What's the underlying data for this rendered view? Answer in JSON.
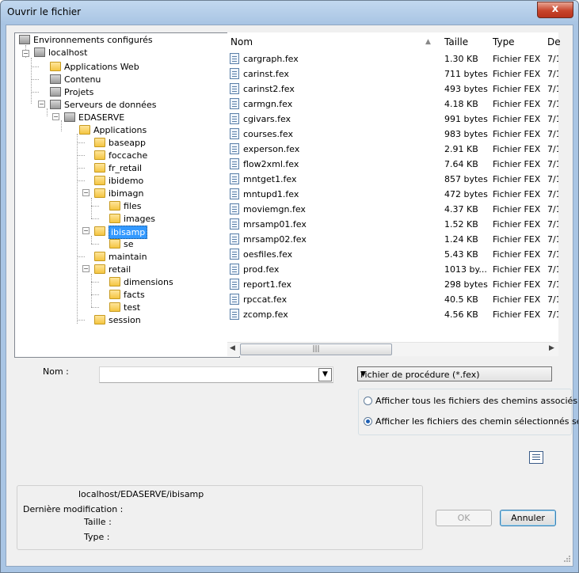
{
  "window": {
    "title": "Ouvrir le fichier",
    "close_label": "x"
  },
  "tree": [
    {
      "label": "Environnements configurés",
      "icon": "network-icon"
    },
    {
      "label": "localhost",
      "icon": "server-icon"
    },
    {
      "label": "Applications Web",
      "icon": "web-folder-icon"
    },
    {
      "label": "Contenu",
      "icon": "content-icon"
    },
    {
      "label": "Projets",
      "icon": "projects-icon"
    },
    {
      "label": "Serveurs de données",
      "icon": "server-icon"
    },
    {
      "label": "EDASERVE",
      "icon": "server-icon"
    },
    {
      "label": "Applications",
      "icon": "folder-open-icon"
    },
    {
      "label": "baseapp",
      "icon": "folder-icon"
    },
    {
      "label": "foccache",
      "icon": "folder-icon"
    },
    {
      "label": "fr_retail",
      "icon": "folder-icon"
    },
    {
      "label": "ibidemo",
      "icon": "folder-icon"
    },
    {
      "label": "ibimagn",
      "icon": "folder-icon"
    },
    {
      "label": "files",
      "icon": "folder-icon"
    },
    {
      "label": "images",
      "icon": "folder-icon"
    },
    {
      "label": "ibisamp",
      "icon": "folder-open-icon"
    },
    {
      "label": "se",
      "icon": "folder-icon"
    },
    {
      "label": "maintain",
      "icon": "folder-icon"
    },
    {
      "label": "retail",
      "icon": "folder-icon"
    },
    {
      "label": "dimensions",
      "icon": "folder-icon"
    },
    {
      "label": "facts",
      "icon": "folder-icon"
    },
    {
      "label": "test",
      "icon": "folder-icon"
    },
    {
      "label": "session",
      "icon": "folder-icon"
    }
  ],
  "files": {
    "columns": {
      "name": "Nom",
      "size": "Taille",
      "type": "Type",
      "date": "De"
    },
    "rows": [
      {
        "name": "cargraph.fex",
        "size": "1.30 KB",
        "type": "Fichier FEX",
        "date": "7/1"
      },
      {
        "name": "carinst.fex",
        "size": "711 bytes",
        "type": "Fichier FEX",
        "date": "7/1"
      },
      {
        "name": "carinst2.fex",
        "size": "493 bytes",
        "type": "Fichier FEX",
        "date": "7/1"
      },
      {
        "name": "carmgn.fex",
        "size": "4.18 KB",
        "type": "Fichier FEX",
        "date": "7/1"
      },
      {
        "name": "cgivars.fex",
        "size": "991 bytes",
        "type": "Fichier FEX",
        "date": "7/1"
      },
      {
        "name": "courses.fex",
        "size": "983 bytes",
        "type": "Fichier FEX",
        "date": "7/1"
      },
      {
        "name": "experson.fex",
        "size": "2.91 KB",
        "type": "Fichier FEX",
        "date": "7/1"
      },
      {
        "name": "flow2xml.fex",
        "size": "7.64 KB",
        "type": "Fichier FEX",
        "date": "7/1"
      },
      {
        "name": "mntget1.fex",
        "size": "857 bytes",
        "type": "Fichier FEX",
        "date": "7/1"
      },
      {
        "name": "mntupd1.fex",
        "size": "472 bytes",
        "type": "Fichier FEX",
        "date": "7/1"
      },
      {
        "name": "moviemgn.fex",
        "size": "4.37 KB",
        "type": "Fichier FEX",
        "date": "7/1"
      },
      {
        "name": "mrsamp01.fex",
        "size": "1.52 KB",
        "type": "Fichier FEX",
        "date": "7/1"
      },
      {
        "name": "mrsamp02.fex",
        "size": "1.24 KB",
        "type": "Fichier FEX",
        "date": "7/1"
      },
      {
        "name": "oesfiles.fex",
        "size": "5.43 KB",
        "type": "Fichier FEX",
        "date": "7/1"
      },
      {
        "name": "prod.fex",
        "size": "1013 by...",
        "type": "Fichier FEX",
        "date": "7/1"
      },
      {
        "name": "report1.fex",
        "size": "298 bytes",
        "type": "Fichier FEX",
        "date": "7/1"
      },
      {
        "name": "rpccat.fex",
        "size": "40.5 KB",
        "type": "Fichier FEX",
        "date": "7/1"
      },
      {
        "name": "zcomp.fex",
        "size": "4.56 KB",
        "type": "Fichier FEX",
        "date": "7/1"
      }
    ]
  },
  "form": {
    "name_label": "Nom :",
    "name_value": "",
    "filetype_value": "Fichier de procédure (*.fex)",
    "radio_all": "Afficher tous les fichiers des chemins associés",
    "radio_selected": "Afficher les fichiers des chemin sélectionnés seuls"
  },
  "info": {
    "path": "localhost/EDASERVE/ibisamp",
    "modified_label": "Dernière modification :",
    "size_label": "Taille :",
    "type_label": "Type :"
  },
  "buttons": {
    "ok": "OK",
    "cancel": "Annuler"
  },
  "colors": {
    "selection": "#3399ff",
    "title_bar": "#b4cfec",
    "close": "#c8452c"
  }
}
